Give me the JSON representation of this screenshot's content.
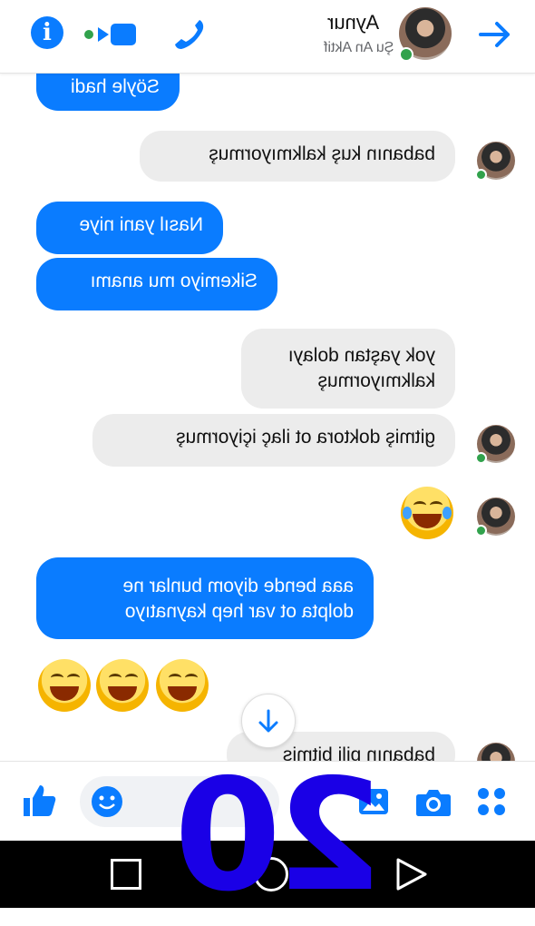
{
  "header": {
    "contact_name": "Aynur",
    "contact_status": "Şu An Aktif"
  },
  "messages": [
    {
      "dir": "out",
      "text": "Söyle hadi"
    },
    {
      "dir": "in",
      "text": "babanın kuş kalkmıyormuş"
    },
    {
      "dir": "out",
      "text": "Nasıl yani niye"
    },
    {
      "dir": "out",
      "text": "Sikemiyo mu anamı"
    },
    {
      "dir": "in",
      "lines": [
        "yok yaştan dolayı",
        "kalkmıyormuş"
      ]
    },
    {
      "dir": "in",
      "text": "gitmiş doktora ot ilaç içiyormuş"
    },
    {
      "dir": "in",
      "emoji": "face-with-tears-of-joy"
    },
    {
      "dir": "out",
      "lines": [
        "aaa bende diyom bunlar ne",
        "dolpta ot var hep kaynatıyo"
      ]
    },
    {
      "dir": "out",
      "emoji": "grinning-squinting-face x3"
    },
    {
      "dir": "in",
      "text": "babanın pili bitmiş"
    }
  ],
  "overlay": {
    "number": "20"
  },
  "colors": {
    "accent": "#0a7cff",
    "online": "#31a24c",
    "overlay": "#1a00e6"
  },
  "icons": [
    "info-icon",
    "video-call-icon",
    "phone-icon",
    "back-arrow-icon",
    "like-icon",
    "smiley-icon",
    "gallery-icon",
    "camera-icon",
    "apps-icon",
    "scroll-down-icon"
  ]
}
